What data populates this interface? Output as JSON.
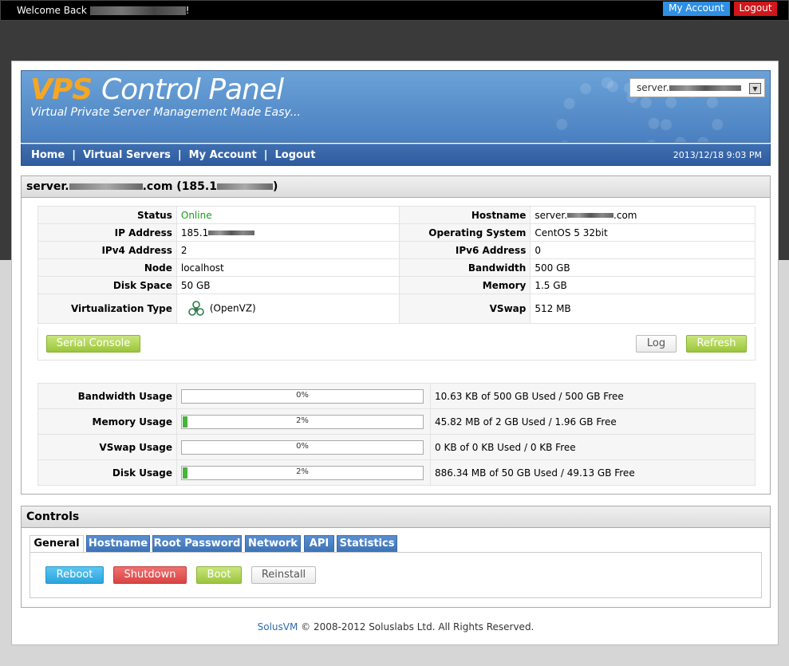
{
  "topbar": {
    "welcome_prefix": "Welcome Back",
    "welcome_suffix": "!",
    "my_account": "My Account",
    "logout": "Logout"
  },
  "header": {
    "brand_vps": "VPS",
    "brand_rest": "Control Panel",
    "tagline": "Virtual Private Server Management Made Easy...",
    "server_select_prefix": "server."
  },
  "nav": {
    "items": [
      "Home",
      "Virtual Servers",
      "My Account",
      "Logout"
    ],
    "separator": "|",
    "datetime": "2013/12/18 9:03 PM"
  },
  "server": {
    "title_prefix": "server.",
    "title_mid": ".com (185.1",
    "title_suffix": ")",
    "info": {
      "status_label": "Status",
      "status_value": "Online",
      "hostname_label": "Hostname",
      "hostname_prefix": "server.",
      "hostname_suffix": ".com",
      "ip_label": "IP Address",
      "ip_prefix": "185.1",
      "os_label": "Operating System",
      "os_value": "CentOS 5 32bit",
      "ipv4_label": "IPv4 Address",
      "ipv4_value": "2",
      "ipv6_label": "IPv6 Address",
      "ipv6_value": "0",
      "node_label": "Node",
      "node_value": "localhost",
      "bandwidth_label": "Bandwidth",
      "bandwidth_value": "500 GB",
      "disk_label": "Disk Space",
      "disk_value": "50 GB",
      "memory_label": "Memory",
      "memory_value": "1.5 GB",
      "virt_label": "Virtualization Type",
      "virt_value": "(OpenVZ)",
      "vswap_label": "VSwap",
      "vswap_value": "512 MB"
    },
    "buttons": {
      "serial_console": "Serial Console",
      "log": "Log",
      "refresh": "Refresh"
    },
    "usage": [
      {
        "label": "Bandwidth Usage",
        "percent_text": "0%",
        "fraction": 0,
        "desc": "10.63 KB of 500 GB Used / 500 GB Free"
      },
      {
        "label": "Memory Usage",
        "percent_text": "2%",
        "fraction": 0.02,
        "desc": "45.82 MB of 2 GB Used / 1.96 GB Free"
      },
      {
        "label": "VSwap Usage",
        "percent_text": "0%",
        "fraction": 0,
        "desc": "0 KB of 0 KB Used / 0 KB Free"
      },
      {
        "label": "Disk Usage",
        "percent_text": "2%",
        "fraction": 0.02,
        "desc": "886.34 MB of 50 GB Used / 49.13 GB Free"
      }
    ]
  },
  "controls": {
    "title": "Controls",
    "tabs": [
      "General",
      "Hostname",
      "Root Password",
      "Network",
      "API",
      "Statistics"
    ],
    "actions": {
      "reboot": "Reboot",
      "shutdown": "Shutdown",
      "boot": "Boot",
      "reinstall": "Reinstall"
    }
  },
  "footer": {
    "link": "SolusVM",
    "text": "© 2008-2012 Soluslabs Ltd. All Rights Reserved."
  },
  "colors": {
    "accent_blue": "#3d72b6",
    "brand_orange": "#f5a623",
    "online_green": "#1a9a1a",
    "logout_red": "#d0171b"
  }
}
